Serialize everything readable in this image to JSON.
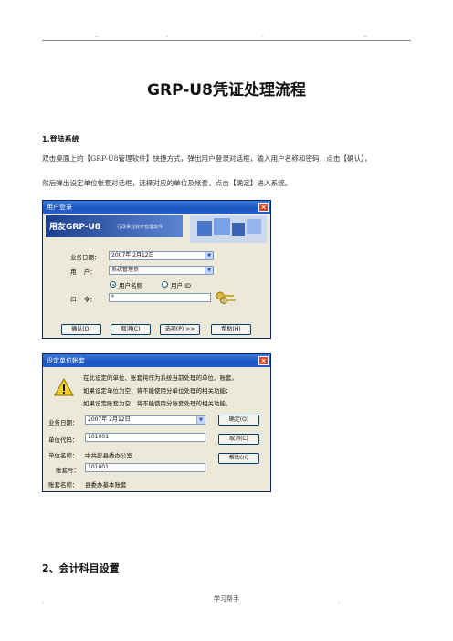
{
  "header": {
    "marks": [
      "..",
      ".",
      ".",
      ".."
    ]
  },
  "title": "GRP-U8凭证处理流程",
  "section1": {
    "heading": "1.登陆系统",
    "line1": "双击桌面上的【GRP-U8管理软件】快捷方式，弹出用户登录对话框，输入用户名称和密码，点击【确认】，",
    "line2": "然后弹出设定单位帐套对话框，选择对应的单位及帐套，点击【确定】进入系统。"
  },
  "login_dialog": {
    "title": "用户登录",
    "banner_logo": "用友GRP-U8",
    "banner_sub": "行政事业财务管理软件",
    "date_label": "业务日期：",
    "date_value": "2007年 2月12日",
    "user_label": "用    户：",
    "user_value": "系统管理员",
    "radio_name": "用户名称",
    "radio_id": "用户 ID",
    "password_label": "口    令：",
    "password_value": "*",
    "confirm": "确认(O)",
    "cancel": "取消(C)",
    "options": "选项(P) >>",
    "help": "帮助(H)"
  },
  "account_dialog": {
    "title": "设定单位帐套",
    "msg1": "在此设定的单位、账套将作为系统当前处理的单位、账套。",
    "msg2": "如果设定单位为空，将不能使用分单位处理的相关功能；",
    "msg3": "如果设定账套为空，将不能使用分账套处理的相关功能。",
    "date_label": "业务日期：",
    "date_value": "2007年 2月12日",
    "unit_code_label": "单位代码：",
    "unit_code_value": "101001",
    "unit_name_label": "单位名称：",
    "unit_name_value": "中共彭县委办公室",
    "account_no_label": "账套号：",
    "account_no_value": "101001",
    "account_name_label": "账套名称：",
    "account_name_value": "县委办基本账套",
    "ok": "确定(O)",
    "cancel": "取消(C)",
    "help": "帮助(H)"
  },
  "section2": {
    "heading": "2、会计科目设置"
  },
  "footer": {
    "text": "学习帮手",
    "left_mark": ".",
    "right_mark": "."
  }
}
